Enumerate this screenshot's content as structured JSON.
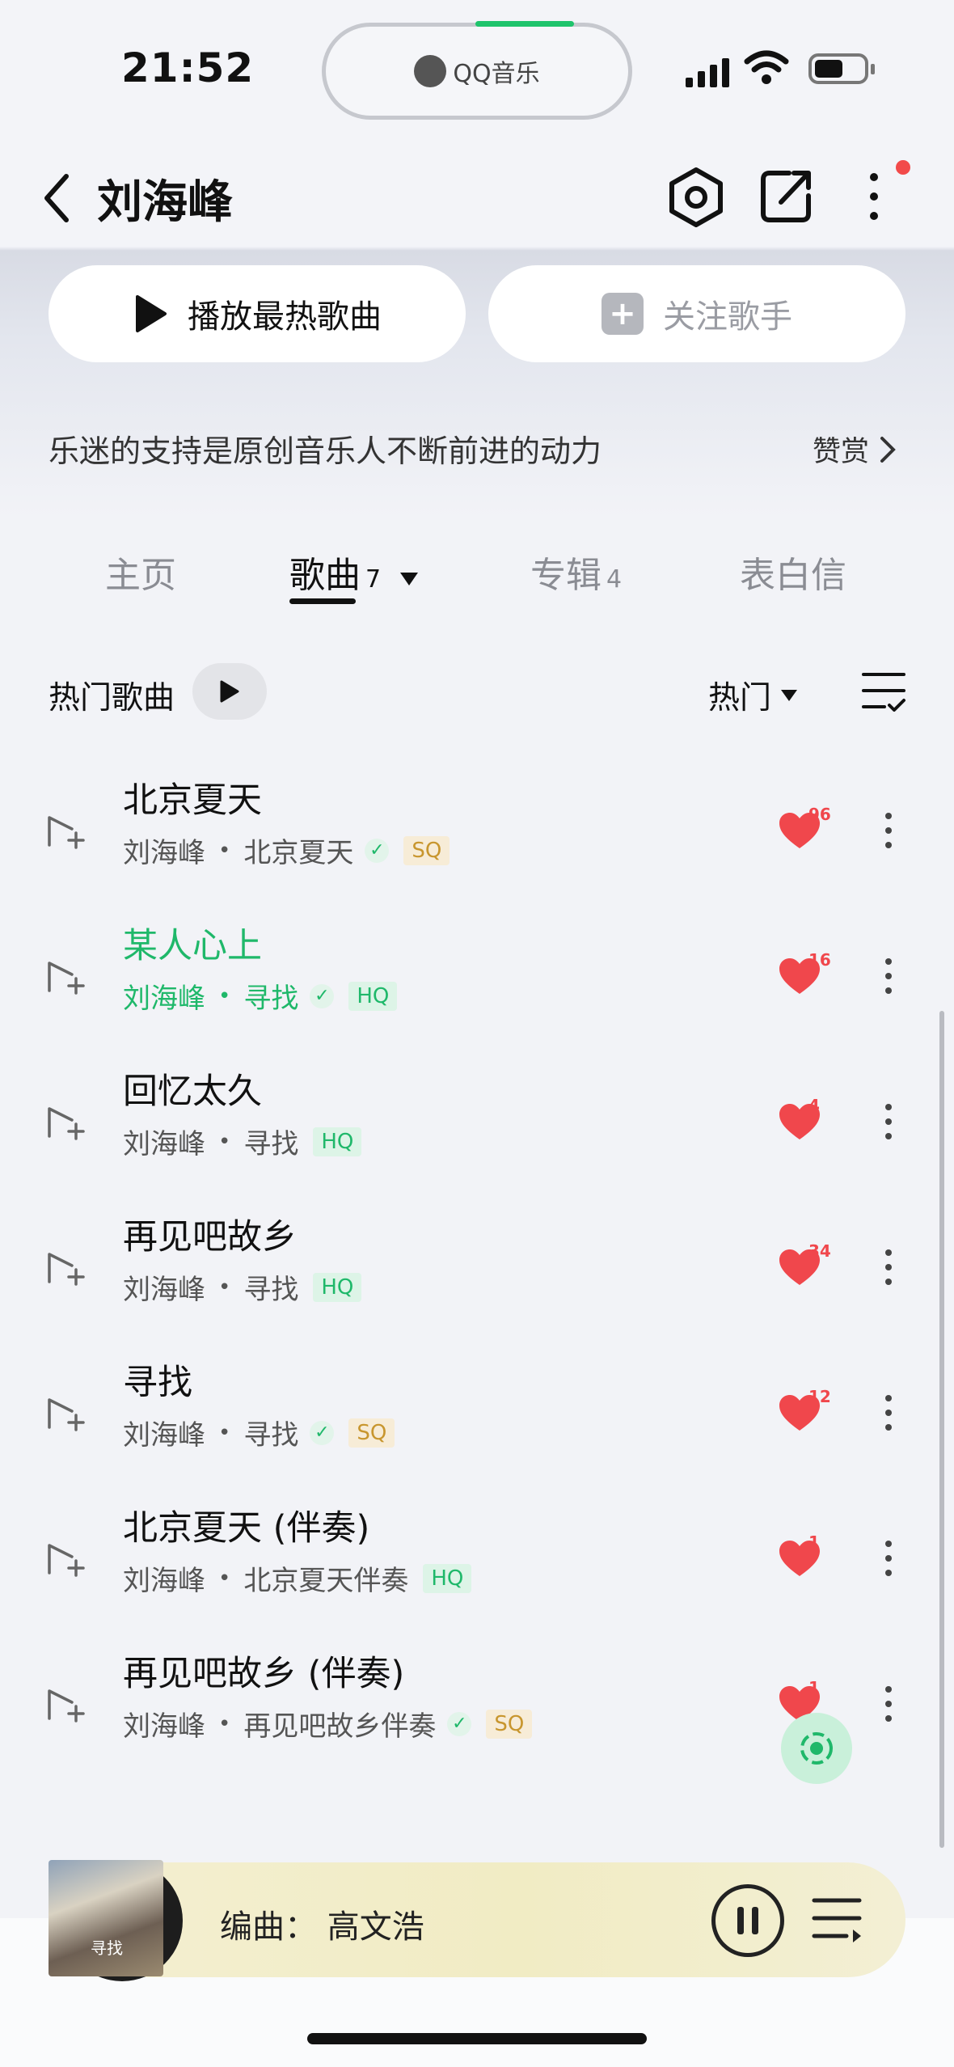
{
  "status": {
    "time": "21:52",
    "island_app": "QQ音乐"
  },
  "nav": {
    "title": "刘海峰"
  },
  "actions": {
    "play_label": "播放最热歌曲",
    "follow_label": "关注歌手"
  },
  "support": {
    "text": "乐迷的支持是原创音乐人不断前进的动力",
    "reward_label": "赞赏"
  },
  "tabs": [
    {
      "label": "主页",
      "count": ""
    },
    {
      "label": "歌曲",
      "count": "7"
    },
    {
      "label": "专辑",
      "count": "4"
    },
    {
      "label": "表白信",
      "count": ""
    }
  ],
  "list": {
    "title": "热门歌曲",
    "sort_label": "热门"
  },
  "songs": [
    {
      "title": "北京夏天",
      "artist": "刘海峰",
      "album": "北京夏天",
      "verified": true,
      "quality": "SQ",
      "likes": "96",
      "playing": false
    },
    {
      "title": "某人心上",
      "artist": "刘海峰",
      "album": "寻找",
      "verified": true,
      "quality": "HQ",
      "likes": "16",
      "playing": true
    },
    {
      "title": "回忆太久",
      "artist": "刘海峰",
      "album": "寻找",
      "verified": false,
      "quality": "HQ",
      "likes": "4",
      "playing": false
    },
    {
      "title": "再见吧故乡",
      "artist": "刘海峰",
      "album": "寻找",
      "verified": false,
      "quality": "HQ",
      "likes": "34",
      "playing": false
    },
    {
      "title": "寻找",
      "artist": "刘海峰",
      "album": "寻找",
      "verified": true,
      "quality": "SQ",
      "likes": "12",
      "playing": false
    },
    {
      "title": "北京夏天 (伴奏)",
      "artist": "刘海峰",
      "album": "北京夏天伴奏",
      "verified": false,
      "quality": "HQ",
      "likes": "1",
      "playing": false
    },
    {
      "title": "再见吧故乡 (伴奏)",
      "artist": "刘海峰",
      "album": "再见吧故乡伴奏",
      "verified": true,
      "quality": "SQ",
      "likes": "1",
      "playing": false
    }
  ],
  "player": {
    "now_text": "编曲：  高文浩",
    "cover_text": "寻找"
  },
  "colors": {
    "accent": "#1fb86a",
    "heart": "#f0474c",
    "sq": "#c8962e"
  }
}
